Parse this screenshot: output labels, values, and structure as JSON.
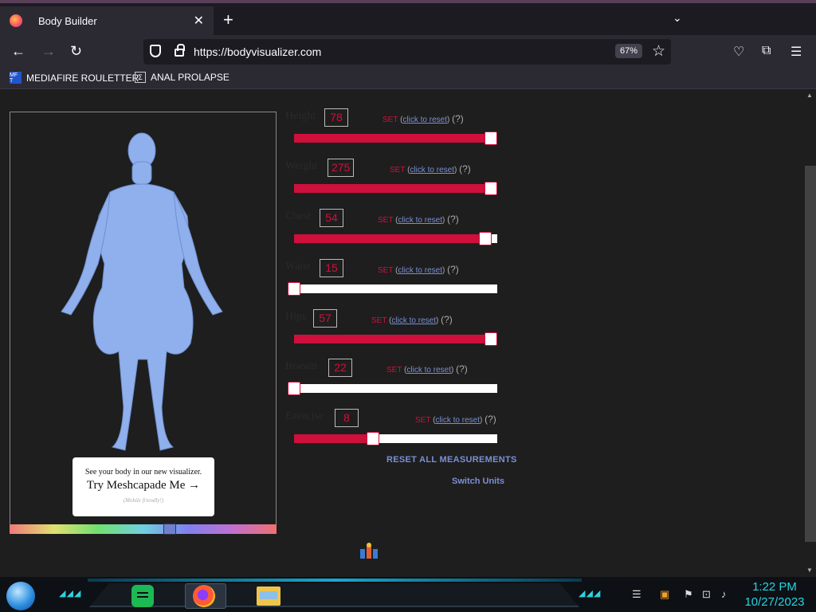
{
  "browser": {
    "tab_title": "Body Builder",
    "tab_close": "✕",
    "new_tab": "+",
    "list_tabs": "⌄",
    "url": "https://bodyvisualizer.com",
    "zoom": "67%",
    "bookmarks": [
      {
        "label": "MEDIAFIRE ROULETTER",
        "icon_text": "MF T"
      },
      {
        "label": "ANAL PROLAPSE",
        "icon_text": "Σ"
      }
    ]
  },
  "viewer": {
    "cta_line1": "See your body in our new visualizer.",
    "cta_line2": "Try Meshcapade Me",
    "cta_arrow": "→",
    "cta_note": "(Mobile friendly!)",
    "body_color": "#8fb0ec"
  },
  "measurements": [
    {
      "name": "Height",
      "value": "78",
      "fraction": 1.0
    },
    {
      "name": "Weight",
      "value": "275",
      "fraction": 1.0
    },
    {
      "name": "Chest",
      "value": "54",
      "fraction": 0.97
    },
    {
      "name": "Waist",
      "value": "15",
      "fraction": 0.0
    },
    {
      "name": "Hips",
      "value": "57",
      "fraction": 1.0
    },
    {
      "name": "Inseam",
      "value": "22",
      "fraction": 0.0
    },
    {
      "name": "Exercise",
      "value": "8",
      "fraction": 0.4
    }
  ],
  "row_text": {
    "set": "SET",
    "open_paren": "(",
    "reset_link": "click to reset",
    "close_paren": ")",
    "help": "(?)"
  },
  "actions": {
    "reset_all": "RESET ALL MEASUREMENTS",
    "switch_units": "Switch Units"
  },
  "taskbar": {
    "time": "1:22 PM",
    "date": "10/27/2023",
    "accent": "#28d4e0"
  }
}
